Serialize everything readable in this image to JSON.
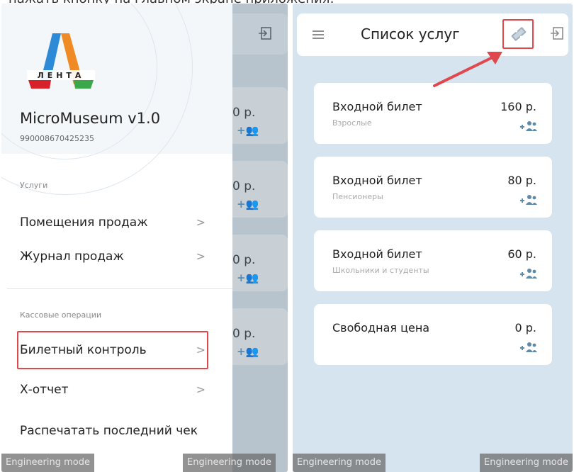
{
  "caption": "нажать кнопку на главном экране приложения:",
  "left_screen": {
    "background": {
      "prices": [
        "0 р.",
        "0 р.",
        "0 р.",
        "0 р."
      ]
    },
    "drawer": {
      "logo_text": "ЛЕНТА",
      "app_name": "MicroMuseum v1.0",
      "device_id": "990008670425235",
      "section_services": "Услуги",
      "items_services": [
        {
          "label": "Помещения продаж"
        },
        {
          "label": "Журнал продаж"
        }
      ],
      "section_cash": "Кассовые операции",
      "items_cash": [
        {
          "label": "Билетный контроль"
        },
        {
          "label": "Х-отчет"
        },
        {
          "label": "Распечатать последний чек"
        }
      ],
      "arrow_glyph": ">"
    },
    "engineering_badges": [
      "Engineering mode",
      "Engineering mode"
    ]
  },
  "right_screen": {
    "title": "Список услуг",
    "services": [
      {
        "name": "Входной билет",
        "subtitle": "Взрослые",
        "price": "160 р."
      },
      {
        "name": "Входной билет",
        "subtitle": "Пенсионеры",
        "price": "80 р."
      },
      {
        "name": "Входной билет",
        "subtitle": "Школьники и студенты",
        "price": "60 р."
      },
      {
        "name": "Свободная цена",
        "subtitle": "",
        "price": "0 р."
      }
    ],
    "engineering_badges": [
      "Engineering mode",
      "Engineering mode"
    ]
  },
  "colors": {
    "accent_red": "#e0484e",
    "icon_blue": "#5f8aa8",
    "screen_bg": "#d6e4f0"
  },
  "icons": {
    "menu": "hamburger-icon",
    "exit": "exit-icon",
    "ticket": "ticket-icon",
    "add_user": "add-user-icon",
    "chevron": "chevron-right-icon"
  }
}
